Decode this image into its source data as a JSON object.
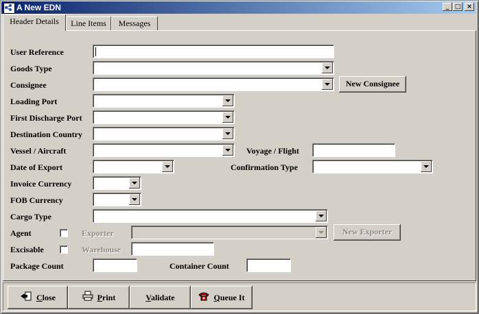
{
  "window": {
    "title": "A New EDN",
    "min": "_",
    "max": "□",
    "close": "×"
  },
  "tabs": [
    "Header Details",
    "Line Items",
    "Messages"
  ],
  "form": {
    "user_reference": "User Reference",
    "goods_type": "Goods Type",
    "consignee": "Consignee",
    "new_consignee": "New Consignee",
    "loading_port": "Loading Port",
    "first_discharge_port": "First Discharge Port",
    "destination_country": "Destination Country",
    "vessel_aircraft": "Vessel / Aircraft",
    "voyage_flight": "Voyage / Flight",
    "date_of_export": "Date of Export",
    "confirmation_type": "Confirmation Type",
    "invoice_currency": "Invoice Currency",
    "fob_currency": "FOB Currency",
    "cargo_type": "Cargo Type",
    "agent": "Agent",
    "exporter": "Exporter",
    "new_exporter": "New Exporter",
    "excisable": "Excisable",
    "warehouse": "Warehouse",
    "package_count": "Package Count",
    "container_count": "Container Count"
  },
  "footer": {
    "close": {
      "first": "C",
      "rest": "lose"
    },
    "print": {
      "first": "P",
      "rest": "rint"
    },
    "validate": {
      "first": "V",
      "rest": "alidate"
    },
    "queue": {
      "first": "Q",
      "rest": "ueue It"
    }
  }
}
